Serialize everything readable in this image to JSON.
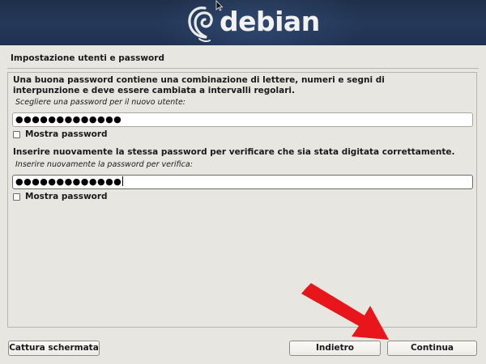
{
  "header": {
    "brand": "debian"
  },
  "page": {
    "title": "Impostazione utenti e password",
    "description": "Una buona password contiene una combinazione di lettere, numeri e segni di interpunzione e deve essere cambiata a intervalli regolari.",
    "password_label": "Scegliere una password per il nuovo utente:",
    "password_value": "●●●●●●●●●●●●●",
    "show_password_1": "Mostra password",
    "verify_description": "Inserire nuovamente la stessa password per verificare che sia stata digitata correttamente.",
    "verify_label": "Inserire nuovamente la password per verifica:",
    "verify_value": "●●●●●●●●●●●●●",
    "show_password_2": "Mostra password"
  },
  "buttons": {
    "screenshot": "Cattura schermata",
    "back": "Indietro",
    "continue": "Continua"
  },
  "annotation": {
    "arrow_color": "#e8151b"
  },
  "icons": {
    "logo": "debian-swirl-icon",
    "cursor": "mouse-pointer-icon",
    "arrow": "red-arrow-icon"
  }
}
